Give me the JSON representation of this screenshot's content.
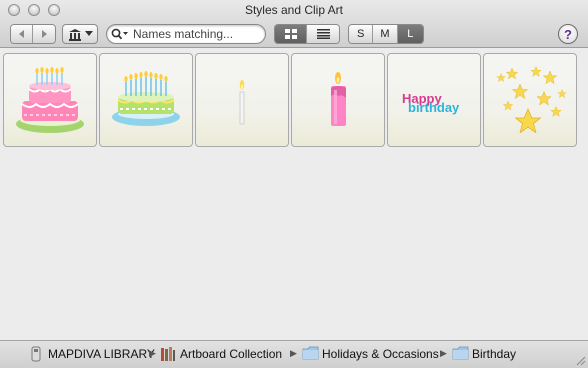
{
  "window": {
    "title": "Styles and Clip Art"
  },
  "toolbar": {
    "back_icon": "back-arrow-icon",
    "forward_icon": "forward-arrow-icon",
    "library_icon": "library-building-icon",
    "search_placeholder": "Names matching...",
    "view_modes": [
      "grid-view-icon",
      "list-view-icon"
    ],
    "view_mode_selected": "grid",
    "sizes": [
      "S",
      "M",
      "L"
    ],
    "size_selected": "L",
    "help_label": "?"
  },
  "clip_art": [
    {
      "name": "pink birthday cake",
      "icon": "pink-cake-icon"
    },
    {
      "name": "green birthday cake",
      "icon": "green-cake-icon"
    },
    {
      "name": "thin white candle",
      "icon": "white-candle-icon"
    },
    {
      "name": "pink candle",
      "icon": "pink-candle-icon"
    },
    {
      "name": "happy birthday text",
      "icon": "happy-birthday-text",
      "text_line1": "Happy",
      "text_line2": "birthday"
    },
    {
      "name": "gold stars",
      "icon": "stars-icon"
    }
  ],
  "breadcrumb": {
    "items": [
      "MAPDIVA LIBRARY",
      "Artboard Collection",
      "Holidays & Occasions",
      "Birthday"
    ]
  },
  "colors": {
    "pink": "#ff7fb0",
    "magenta_text": "#d63b8f",
    "cyan_text": "#2bb3d8",
    "green": "#9ed26a",
    "star_gold": "#f7d64a",
    "help_purple": "#5b2d8e"
  }
}
